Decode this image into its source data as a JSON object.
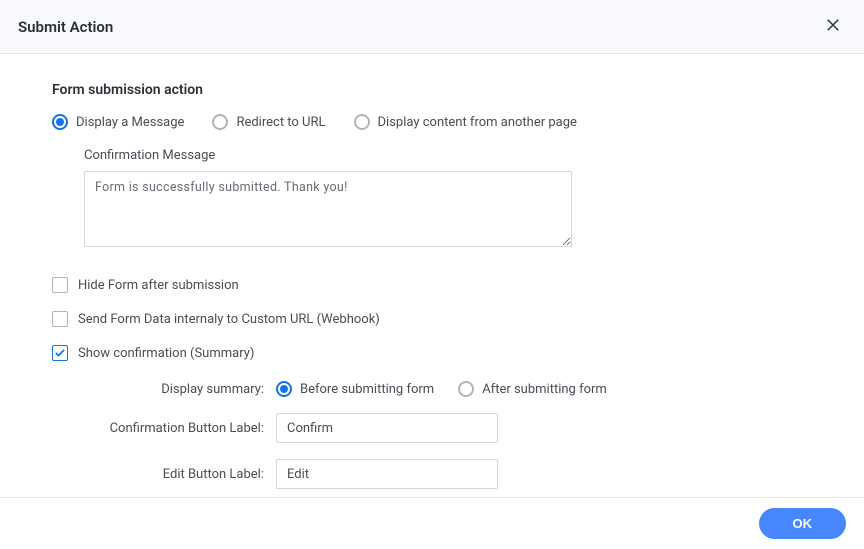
{
  "header": {
    "title": "Submit Action"
  },
  "section": {
    "title": "Form submission action"
  },
  "action_radios": {
    "display_message": "Display a Message",
    "redirect_url": "Redirect to URL",
    "display_content": "Display content from another page"
  },
  "confirmation": {
    "label": "Confirmation Message",
    "value": "Form is successfully submitted. Thank you!"
  },
  "checkboxes": {
    "hide_form": "Hide Form after submission",
    "webhook": "Send Form Data internaly to Custom URL (Webhook)",
    "show_summary": "Show confirmation (Summary)"
  },
  "summary": {
    "display_label": "Display summary:",
    "before": "Before submitting form",
    "after": "After submitting form",
    "confirm_label": "Confirmation Button Label:",
    "confirm_value": "Confirm",
    "edit_label": "Edit Button Label:",
    "edit_value": "Edit"
  },
  "footer": {
    "ok": "OK"
  }
}
